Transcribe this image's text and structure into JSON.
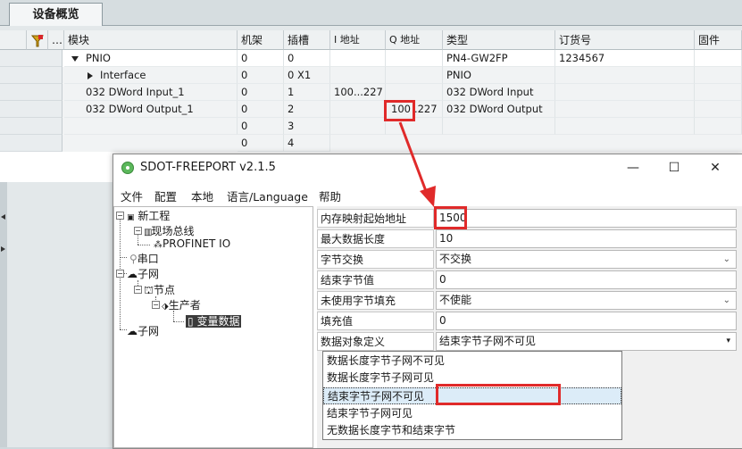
{
  "tab": {
    "label": "设备概览"
  },
  "table": {
    "columns": [
      "模块",
      "机架",
      "插槽",
      "I 地址",
      "Q 地址",
      "类型",
      "订货号",
      "固件"
    ],
    "rows": [
      {
        "module": "PNIO",
        "rack": "0",
        "slot": "0",
        "i_addr": "",
        "q_addr": "",
        "type": "PN4-GW2FP",
        "order": "1234567"
      },
      {
        "module": "Interface",
        "rack": "0",
        "slot": "0 X1",
        "i_addr": "",
        "q_addr": "",
        "type": "PNIO",
        "order": ""
      },
      {
        "module": "032 DWord Input_1",
        "rack": "0",
        "slot": "1",
        "i_addr": "100...227",
        "q_addr": "",
        "type": "032 DWord Input",
        "order": ""
      },
      {
        "module": "032 DWord Output_1",
        "rack": "0",
        "slot": "2",
        "i_addr": "",
        "q_addr_hl": "100",
        "q_addr_rest": ".227",
        "type": "032 DWord Output",
        "order": ""
      },
      {
        "module": "",
        "rack": "0",
        "slot": "3",
        "i_addr": "",
        "q_addr": "",
        "type": "",
        "order": ""
      },
      {
        "module": "",
        "rack": "0",
        "slot": "4",
        "i_addr": "",
        "q_addr": "",
        "type": "",
        "order": ""
      }
    ]
  },
  "window": {
    "title": "SDOT-FREEPORT v2.1.5",
    "minimize": "—",
    "maximize": "☐",
    "close": "✕",
    "menu": [
      "文件",
      "配置",
      "本地",
      "语言/Language",
      "帮助"
    ]
  },
  "tree": {
    "root": "新工程",
    "fieldbus": "现场总线",
    "profinet": "PROFINET IO",
    "serial": "串口",
    "subnet1": "子网",
    "node": "节点",
    "producer": "生产者",
    "variable": "变量数据",
    "subnet2": "子网"
  },
  "props": [
    {
      "label": "内存映射起始地址",
      "value": "1500",
      "dropdown": false
    },
    {
      "label": "最大数据长度",
      "value": "10",
      "dropdown": false
    },
    {
      "label": "字节交换",
      "value": "不交换",
      "dropdown": true
    },
    {
      "label": "结束字节值",
      "value": "0",
      "dropdown": false
    },
    {
      "label": "未使用字节填充",
      "value": "不使能",
      "dropdown": true
    },
    {
      "label": "填充值",
      "value": "0",
      "dropdown": false
    },
    {
      "label": "数据对象定义",
      "value": "结束字节子网不可见",
      "dropdown": true
    }
  ],
  "dropdown_options": [
    "数据长度字节子网不可见",
    "数据长度字节子网可见",
    "结束字节子网不可见",
    "结束字节子网可见",
    "无数据长度字节和结束字节"
  ],
  "colors": {
    "annotation": "#e02a2a",
    "selection": "#dcecf8"
  }
}
